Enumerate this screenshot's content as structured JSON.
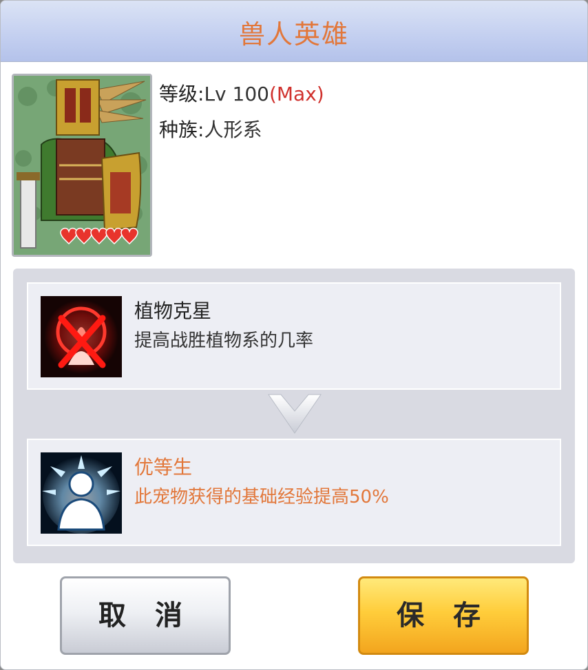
{
  "dialog": {
    "title": "兽人英雄"
  },
  "pet": {
    "level_label": "等级:",
    "level_value": "Lv 100",
    "level_max": "(Max)",
    "race_label": "种族:",
    "race_value": "人形系",
    "hearts": 5
  },
  "skills": {
    "current": {
      "name": "植物克星",
      "description": "提高战胜植物系的几率",
      "icon": "crossed-plant-icon"
    },
    "new": {
      "name": "优等生",
      "description": "此宠物获得的基础经验提高50%",
      "icon": "glowing-person-icon"
    }
  },
  "buttons": {
    "cancel": "取 消",
    "save": "保 存"
  },
  "colors": {
    "title": "#e2773a",
    "max": "#d0312d",
    "save_button": "#ffcd3b"
  }
}
